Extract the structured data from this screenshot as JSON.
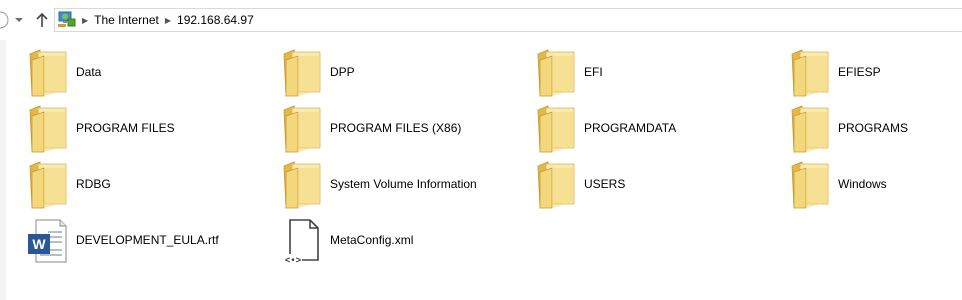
{
  "address": {
    "crumbs": [
      "The Internet",
      "192.168.64.97"
    ]
  },
  "items": [
    {
      "label": "Data",
      "type": "folder"
    },
    {
      "label": "DPP",
      "type": "folder"
    },
    {
      "label": "EFI",
      "type": "folder"
    },
    {
      "label": "EFIESP",
      "type": "folder"
    },
    {
      "label": "PROGRAM FILES",
      "type": "folder"
    },
    {
      "label": "PROGRAM FILES (X86)",
      "type": "folder"
    },
    {
      "label": "PROGRAMDATA",
      "type": "folder"
    },
    {
      "label": "PROGRAMS",
      "type": "folder"
    },
    {
      "label": "RDBG",
      "type": "folder"
    },
    {
      "label": "System Volume Information",
      "type": "folder"
    },
    {
      "label": "USERS",
      "type": "folder"
    },
    {
      "label": "Windows",
      "type": "folder"
    },
    {
      "label": "DEVELOPMENT_EULA.rtf",
      "type": "word-doc"
    },
    {
      "label": "MetaConfig.xml",
      "type": "xml-file"
    }
  ],
  "colors": {
    "folder_main": "#f3d77c",
    "folder_back": "#e3b74a",
    "word_blue": "#2b5797"
  }
}
